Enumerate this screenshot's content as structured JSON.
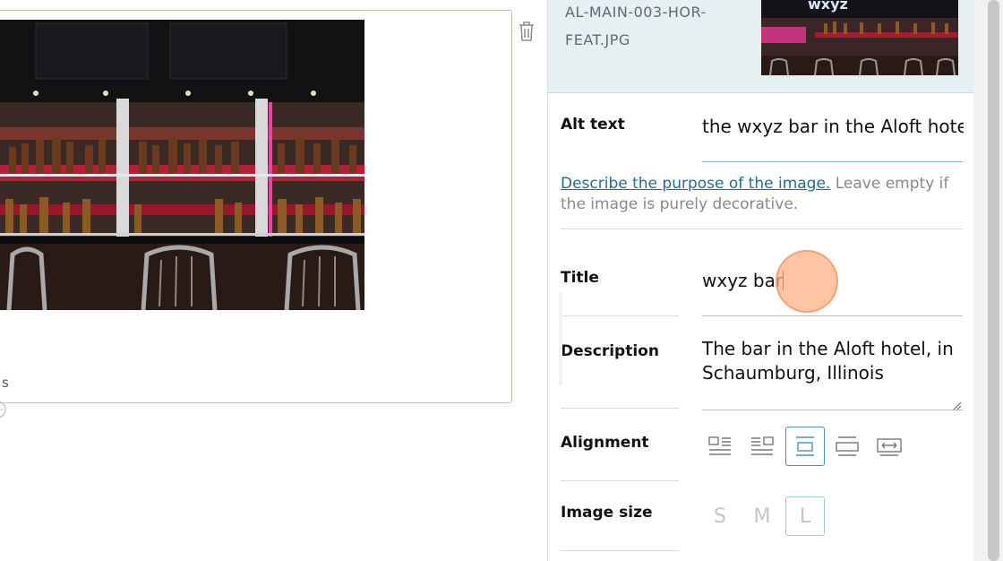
{
  "sidebar": {
    "file_name": "AL-MAIN-003-HOR-FEAT.JPG",
    "thumb_logo": "wxyz",
    "alt_text": {
      "label": "Alt text",
      "value": "the wxyz bar in the Aloft hotel in Schaumburg, Illinois",
      "help_link": "Describe the purpose of the image.",
      "help_text": " Leave empty if the image is purely decorative."
    },
    "title": {
      "label": "Title",
      "value": "wxyz bar"
    },
    "description": {
      "label": "Description",
      "value": "The bar in the Aloft hotel, in Schaumburg, Illinois"
    },
    "alignment": {
      "label": "Alignment",
      "options": [
        "align-left",
        "align-right",
        "align-center",
        "align-wide",
        "align-full"
      ],
      "selected": "align-center"
    },
    "image_size": {
      "label": "Image size",
      "options": [
        "S",
        "M",
        "L"
      ],
      "selected": "L"
    }
  },
  "editor": {
    "caption_stub": "s"
  },
  "colors": {
    "accent": "#4a90b8",
    "header_bg": "#e6eff1"
  }
}
